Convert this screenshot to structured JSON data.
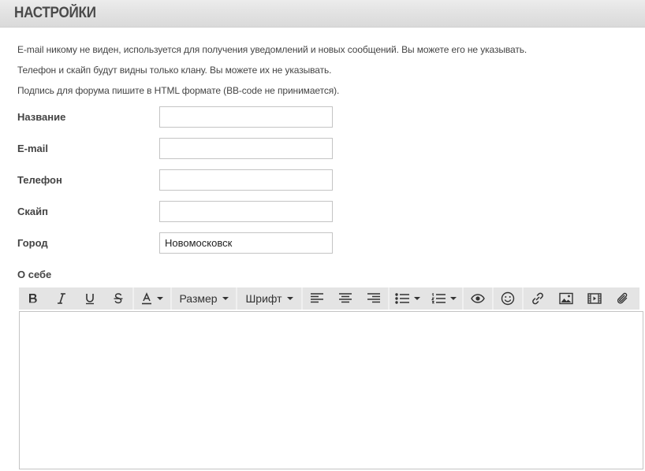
{
  "header": {
    "title": "НАСТРОЙКИ"
  },
  "notes": [
    "E-mail никому не виден, используется для получения уведомлений и новых сообщений. Вы можете его не указывать.",
    "Телефон и скайп будут видны только клану. Вы можете их не указывать.",
    "Подпись для форума пишите в HTML формате (BB-code не принимается)."
  ],
  "form": {
    "name_label": "Название",
    "name_value": "",
    "email_label": "E-mail",
    "email_value": "",
    "phone_label": "Телефон",
    "phone_value": "",
    "skype_label": "Скайп",
    "skype_value": "",
    "city_label": "Город",
    "city_value": "Новомосковск",
    "about_label": "О себе"
  },
  "toolbar": {
    "font_size_label": "Размер",
    "font_family_label": "Шрифт",
    "icons": [
      "bold-icon",
      "italic-icon",
      "underline-icon",
      "strikethrough-icon",
      "text-color-icon",
      "align-left-icon",
      "align-center-icon",
      "align-right-icon",
      "bullet-list-icon",
      "numbered-list-icon",
      "preview-icon",
      "emoji-icon",
      "link-icon",
      "image-icon",
      "video-icon",
      "attach-icon"
    ]
  },
  "colors": {
    "header_bg": "#e2e2e2",
    "toolbar_bg": "#e4e4e4",
    "border": "#c4c4c4"
  }
}
